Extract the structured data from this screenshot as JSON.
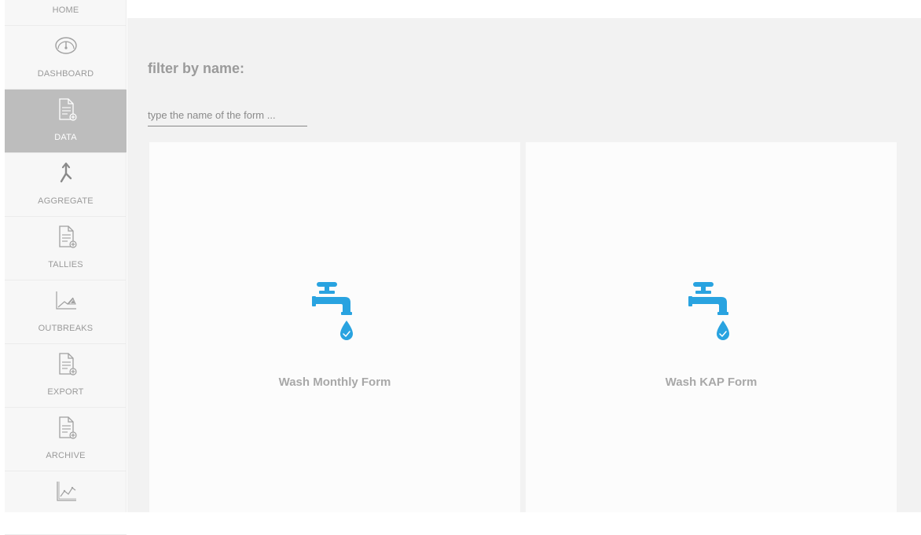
{
  "sidebar": {
    "items": [
      {
        "label": "HOME",
        "icon": "home-icon",
        "active": false
      },
      {
        "label": "DASHBOARD",
        "icon": "gauge-icon",
        "active": false
      },
      {
        "label": "DATA",
        "icon": "document-add-icon",
        "active": true
      },
      {
        "label": "AGGREGATE",
        "icon": "merge-arrow-icon",
        "active": false
      },
      {
        "label": "TALLIES",
        "icon": "document-add-icon",
        "active": false
      },
      {
        "label": "OUTBREAKS",
        "icon": "trend-chart-icon",
        "active": false
      },
      {
        "label": "EXPORT",
        "icon": "document-add-icon",
        "active": false
      },
      {
        "label": "ARCHIVE",
        "icon": "document-add-icon",
        "active": false
      },
      {
        "label": "",
        "icon": "line-chart-icon",
        "active": false
      }
    ],
    "active_bg": "#bdbdbd"
  },
  "filter": {
    "title": "filter by name:",
    "placeholder": "type the name of the form ..."
  },
  "forms": [
    {
      "title": "Wash Monthly Form",
      "icon": "water-tap-icon"
    },
    {
      "title": "Wash KAP Form",
      "icon": "water-tap-icon"
    }
  ],
  "colors": {
    "accent": "#29a3e0",
    "background": "#f2f2f2",
    "card": "#fcfcfc"
  }
}
